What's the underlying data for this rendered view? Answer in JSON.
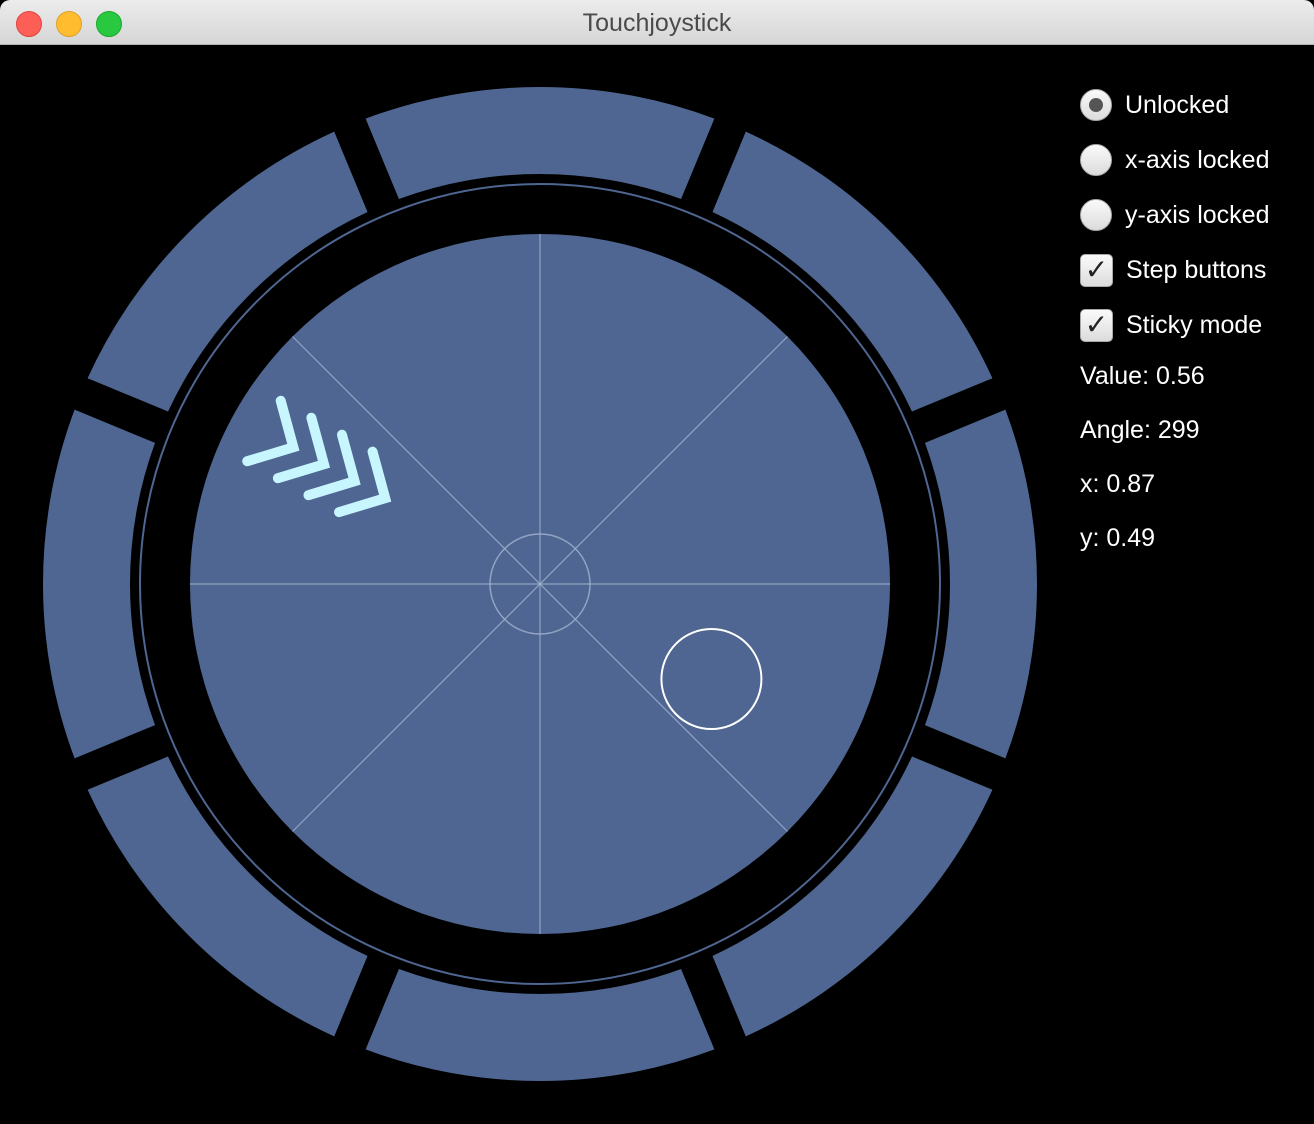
{
  "window": {
    "title": "Touchjoystick"
  },
  "colors": {
    "segment": "#4e6691",
    "grid": "#a9b8d4",
    "knob": "#ffffff",
    "arrow": "#c8f6ff"
  },
  "options": [
    {
      "label": "Unlocked",
      "type": "radio",
      "checked": true
    },
    {
      "label": "x-axis locked",
      "type": "radio",
      "checked": false
    },
    {
      "label": "y-axis locked",
      "type": "radio",
      "checked": false
    },
    {
      "label": "Step buttons",
      "type": "checkbox",
      "checked": true
    },
    {
      "label": "Sticky mode",
      "type": "checkbox",
      "checked": true
    }
  ],
  "readouts": {
    "value": "Value: 0.56",
    "angle": "Angle: 299",
    "x": "x: 0.87",
    "y": "y: 0.49"
  },
  "joystick": {
    "step_buttons": 8,
    "value": 0.56,
    "angle": 299,
    "direction_arrows": 4
  }
}
